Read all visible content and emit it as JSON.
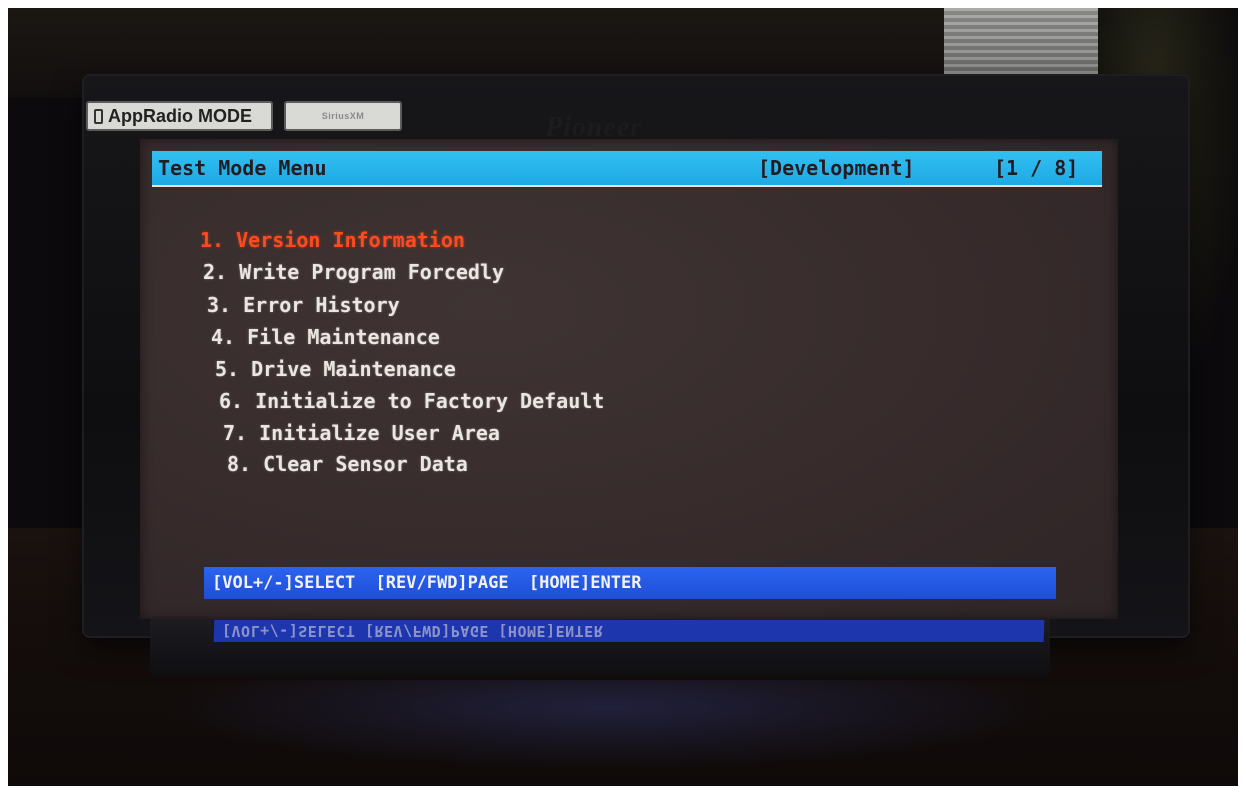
{
  "badges": {
    "approadio": "AppRadio MODE",
    "sirius": "SiriusXM"
  },
  "brand": "Pioneer",
  "header": {
    "title": "Test Mode Menu",
    "mode": "[Development]",
    "page": "[1 / 8]"
  },
  "menu": {
    "selected_index": 0,
    "items": [
      "1. Version Information",
      "2. Write Program Forcedly",
      "3. Error History",
      "4. File Maintenance",
      "5. Drive Maintenance",
      "6. Initialize to Factory Default",
      "7. Initialize User Area",
      "8. Clear Sensor Data"
    ]
  },
  "footer": {
    "select": "[VOL+/-]SELECT",
    "page": "[REV/FWD]PAGE",
    "enter": "[HOME]ENTER",
    "reflection": "[VOL+/-]SELECT [REV/FWD]PAGE [HOME]ENTER"
  },
  "colors": {
    "title_bar": "#1ea9e3",
    "footer_bar": "#1e4ed8",
    "selected_item": "#ff4a1e",
    "menu_text": "#ece6e2",
    "screen_bg": "#362a2b"
  }
}
